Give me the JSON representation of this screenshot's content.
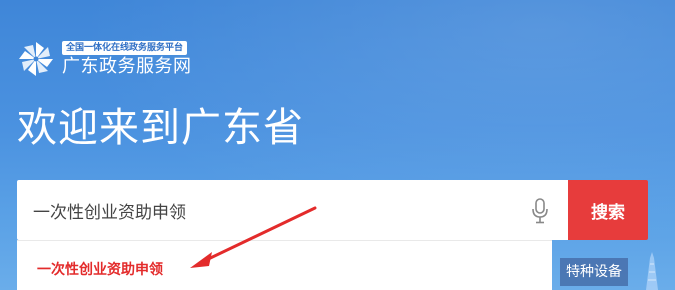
{
  "header": {
    "badge_text": "全国一体化在线政务服务平台",
    "portal_name": "广东政务服务网",
    "logo_icon": "pinwheel-logo-icon"
  },
  "hero": {
    "welcome_text": "欢迎来到广东省"
  },
  "search": {
    "value": "一次性创业资助申领",
    "button_label": "搜索",
    "mic_icon": "microphone-icon"
  },
  "suggestions": [
    {
      "label": "一次性创业资助申领"
    }
  ],
  "side_tag": {
    "label": "特种设备"
  },
  "colors": {
    "background_top": "#3f86d8",
    "background_bottom": "#6aadea",
    "search_button": "#e73c3c",
    "suggestion_text": "#e32b2b",
    "annotation_arrow": "#e32b2b"
  }
}
